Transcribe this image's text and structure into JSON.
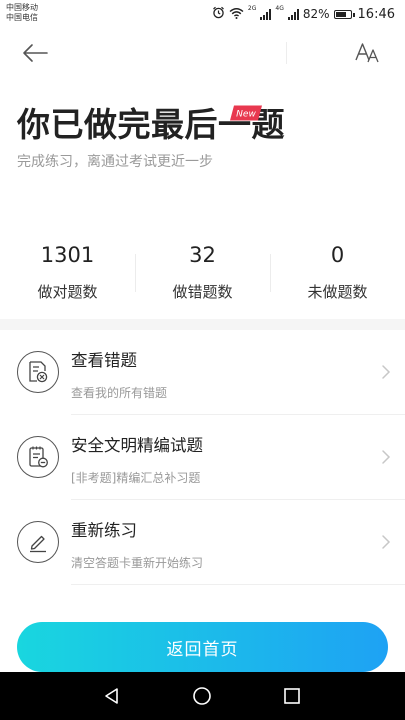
{
  "status_bar": {
    "carrier_1": "中国移动",
    "carrier_2": "中国电信",
    "network_1": "2G",
    "network_2": "4G",
    "battery": "82%",
    "battery_level": 0.82,
    "time": "16:46"
  },
  "navbar": {
    "back_icon": "arrow-left-icon",
    "font_icon": "font-size-icon"
  },
  "header": {
    "title": "你已做完最后一题",
    "subtitle": "完成练习，离通过考试更近一步"
  },
  "stats": [
    {
      "value": "1301",
      "label": "做对题数"
    },
    {
      "value": "32",
      "label": "做错题数"
    },
    {
      "value": "0",
      "label": "未做题数"
    }
  ],
  "menu": [
    {
      "title": "查看错题",
      "desc": "查看我的所有错题",
      "icon": "wrong-questions-icon"
    },
    {
      "title": "安全文明精编试题",
      "desc": "[非考题]精编汇总补习题",
      "icon": "exam-notes-icon",
      "badge": "New"
    },
    {
      "title": "重新练习",
      "desc": "清空答题卡重新开始练习",
      "icon": "pen-edit-icon"
    }
  ],
  "home_button": "返回首页",
  "colors": {
    "accent_start": "#19d6df",
    "accent_end": "#1ea2f4",
    "badge": "#e8384f"
  }
}
